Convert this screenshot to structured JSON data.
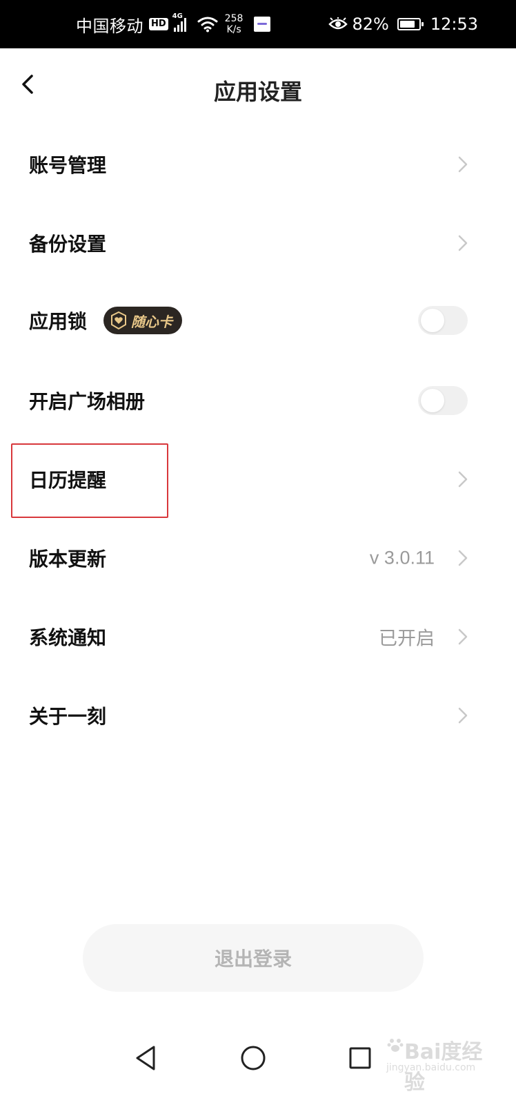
{
  "status_bar": {
    "carrier": "中国移动",
    "hd": "HD",
    "network": "4G",
    "speed_value": "258",
    "speed_unit": "K/s",
    "battery_percent": "82%",
    "battery_level": 0.82,
    "time": "12:53",
    "icons": [
      "hd-icon",
      "signal-icon",
      "wifi-icon",
      "notification-icon",
      "eye-comfort-icon",
      "battery-icon"
    ]
  },
  "header": {
    "title": "应用设置",
    "back_icon": "chevron-left-icon"
  },
  "settings": {
    "items": [
      {
        "label": "账号管理",
        "control": "chevron"
      },
      {
        "label": "备份设置",
        "control": "chevron"
      },
      {
        "label": "应用锁",
        "control": "toggle",
        "toggle_on": false,
        "badge": "随心卡"
      },
      {
        "label": "开启广场相册",
        "control": "toggle",
        "toggle_on": false
      },
      {
        "label": "日历提醒",
        "control": "chevron",
        "highlighted": true
      },
      {
        "label": "版本更新",
        "control": "chevron",
        "value": "v 3.0.11"
      },
      {
        "label": "系统通知",
        "control": "chevron",
        "value": "已开启"
      },
      {
        "label": "关于一刻",
        "control": "chevron"
      }
    ]
  },
  "logout": {
    "label": "退出登录"
  },
  "nav_bar": {
    "icons": [
      "back-triangle-icon",
      "home-circle-icon",
      "recents-square-icon"
    ]
  },
  "watermark": {
    "main": "Bai度经验",
    "sub": "jingyan.baidu.com"
  },
  "colors": {
    "status_bar_bg": "#000000",
    "title": "#222222",
    "label": "#111111",
    "value": "#9a9a9a",
    "highlight_border": "#d8373b",
    "badge_bg": "#2b2622",
    "badge_text": "#e9c889",
    "logout_bg": "#f6f6f6",
    "logout_text": "#b4b4b4"
  }
}
